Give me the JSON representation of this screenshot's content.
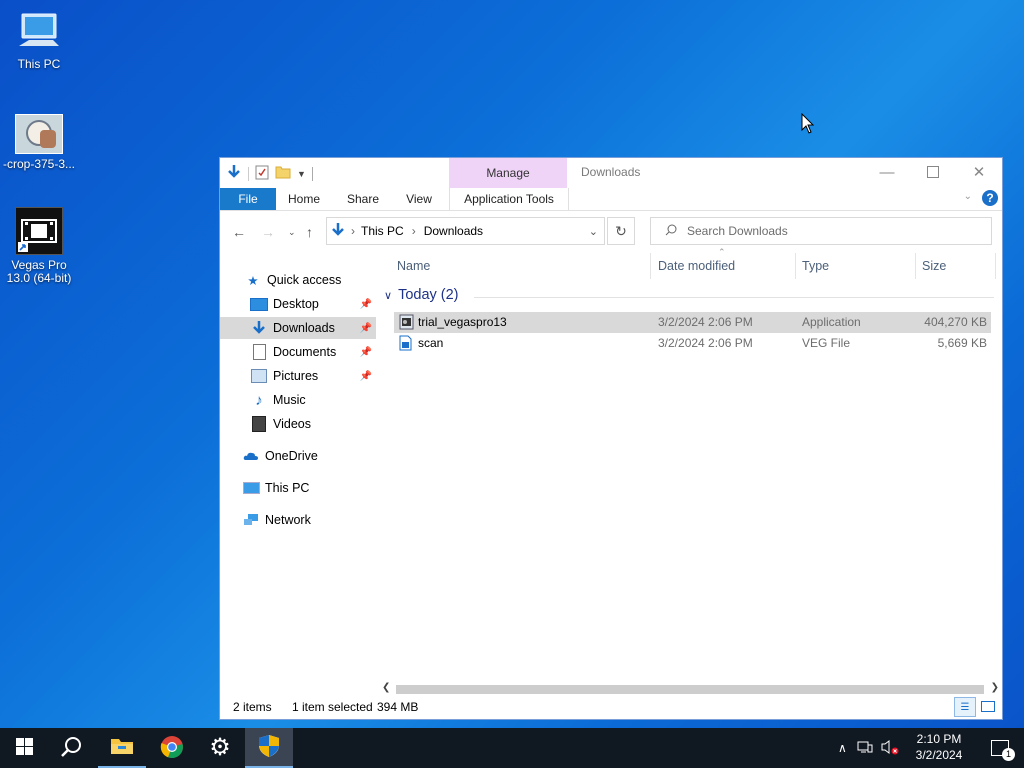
{
  "desktop": {
    "icons": [
      {
        "label": "This PC",
        "icon": "this-pc-icon"
      },
      {
        "label": "-crop-375-3...",
        "icon": "image-file-icon"
      },
      {
        "label": "Vegas Pro 13.0 (64-bit)",
        "icon": "vegas-pro-shortcut-icon"
      }
    ]
  },
  "window": {
    "title": "Downloads",
    "context_tab_group": "Manage",
    "tabs": [
      "File",
      "Home",
      "Share",
      "View",
      "Application Tools"
    ],
    "address": {
      "segments": [
        "This PC",
        "Downloads"
      ]
    },
    "search": {
      "placeholder": "Search Downloads"
    },
    "nav": [
      {
        "label": "Quick access",
        "icon": "star-icon",
        "pinned": false
      },
      {
        "label": "Desktop",
        "icon": "desktop-folder-icon",
        "pinned": true
      },
      {
        "label": "Downloads",
        "icon": "downloads-folder-icon",
        "pinned": true,
        "selected": true
      },
      {
        "label": "Documents",
        "icon": "documents-folder-icon",
        "pinned": true
      },
      {
        "label": "Pictures",
        "icon": "pictures-folder-icon",
        "pinned": true
      },
      {
        "label": "Music",
        "icon": "music-folder-icon",
        "pinned": false
      },
      {
        "label": "Videos",
        "icon": "videos-folder-icon",
        "pinned": false
      },
      {
        "label": "OneDrive",
        "icon": "onedrive-icon",
        "pinned": false
      },
      {
        "label": "This PC",
        "icon": "this-pc-icon",
        "pinned": false
      },
      {
        "label": "Network",
        "icon": "network-icon",
        "pinned": false
      }
    ],
    "columns": [
      "Name",
      "Date modified",
      "Type",
      "Size"
    ],
    "group_label": "Today (2)",
    "files": [
      {
        "name": "trial_vegaspro13",
        "date": "3/2/2024 2:06 PM",
        "type": "Application",
        "size": "404,270 KB",
        "selected": true
      },
      {
        "name": "scan",
        "date": "3/2/2024 2:06 PM",
        "type": "VEG File",
        "size": "5,669 KB",
        "selected": false
      }
    ],
    "status": {
      "items": "2 items",
      "selected": "1 item selected",
      "size": "394 MB"
    }
  },
  "taskbar": {
    "apps": [
      "start-icon",
      "search-icon",
      "file-explorer-icon",
      "chrome-icon",
      "settings-icon",
      "installer-shield-icon"
    ],
    "time": "2:10 PM",
    "date": "3/2/2024",
    "notifications": "1"
  }
}
